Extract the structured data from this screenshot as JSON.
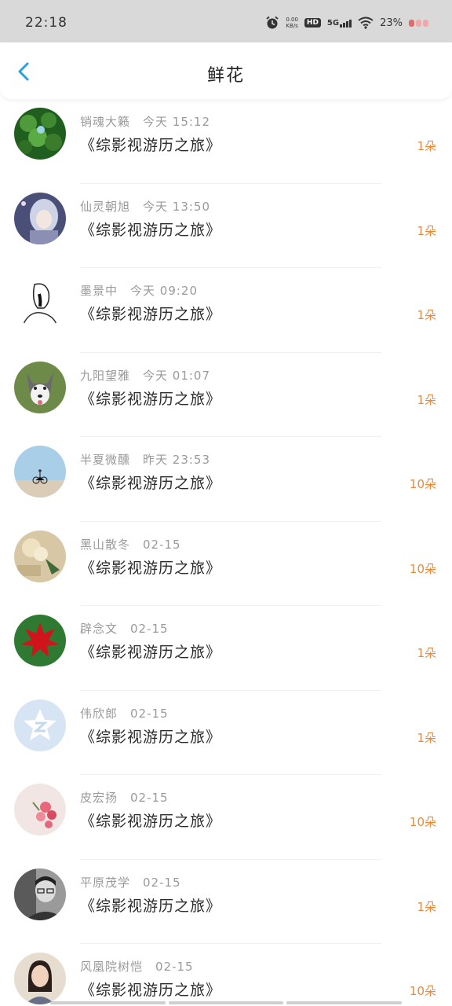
{
  "status": {
    "time": "22:18",
    "speed_value": "0.00",
    "speed_unit": "KB/s",
    "hd": "HD",
    "network": "5G",
    "battery": "23%",
    "icons": [
      "alarm-icon",
      "wifi-icon",
      "signal-icon",
      "battery-icon"
    ]
  },
  "header": {
    "title": "鲜花",
    "back_icon": "chevron-left-icon",
    "accent": "#2aa0e0"
  },
  "colors": {
    "count": "#e98a3c",
    "meta": "#9a9a9a",
    "book": "#2b2b2b"
  },
  "items": [
    {
      "name": "销魂大籁",
      "time": "今天 15:12",
      "book": "《综影视游历之旅》",
      "count": "1朵",
      "avatar": "clover"
    },
    {
      "name": "仙灵朝旭",
      "time": "今天 13:50",
      "book": "《综影视游历之旅》",
      "count": "1朵",
      "avatar": "anime-girl"
    },
    {
      "name": "墨景中",
      "time": "今天 09:20",
      "book": "《综影视游历之旅》",
      "count": "1朵",
      "avatar": "sketch"
    },
    {
      "name": "九阳望雅",
      "time": "今天 01:07",
      "book": "《综影视游历之旅》",
      "count": "1朵",
      "avatar": "husky"
    },
    {
      "name": "半夏微醺",
      "time": "昨天 23:53",
      "book": "《综影视游历之旅》",
      "count": "10朵",
      "avatar": "cyclist"
    },
    {
      "name": "黑山散冬",
      "time": "02-15",
      "book": "《综影视游历之旅》",
      "count": "10朵",
      "avatar": "flowers-beige"
    },
    {
      "name": "辟念文",
      "time": "02-15",
      "book": "《综影视游历之旅》",
      "count": "1朵",
      "avatar": "red-leaf"
    },
    {
      "name": "伟欣郎",
      "time": "02-15",
      "book": "《综影视游历之旅》",
      "count": "1朵",
      "avatar": "qq-default"
    },
    {
      "name": "皮宏扬",
      "time": "02-15",
      "book": "《综影视游历之旅》",
      "count": "10朵",
      "avatar": "pink-flowers"
    },
    {
      "name": "平原茂学",
      "time": "02-15",
      "book": "《综影视游历之旅》",
      "count": "1朵",
      "avatar": "bw-portrait"
    },
    {
      "name": "风凰院树恺",
      "time": "02-15",
      "book": "《综影视游历之旅》",
      "count": "10朵",
      "avatar": "girl-portrait"
    }
  ]
}
